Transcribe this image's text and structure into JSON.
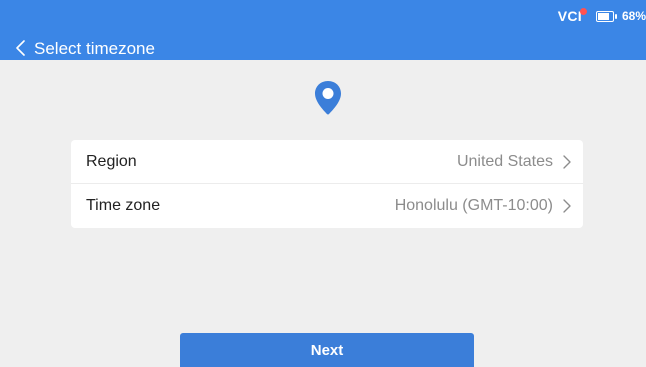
{
  "status_bar": {
    "vci_label": "VCI",
    "battery_percent": "68%",
    "battery_level": 0.68
  },
  "header": {
    "title": "Select timezone",
    "back_icon": "chevron-left-icon"
  },
  "main": {
    "icon": "location-pin-icon",
    "rows": [
      {
        "label": "Region",
        "value": "United States"
      },
      {
        "label": "Time zone",
        "value": "Honolulu (GMT-10:00)"
      }
    ]
  },
  "footer": {
    "next_label": "Next"
  },
  "colors": {
    "header_bg": "#3b86e6",
    "accent": "#3b7ed9",
    "page_bg": "#efefef",
    "vci_dot": "#ff5252"
  }
}
